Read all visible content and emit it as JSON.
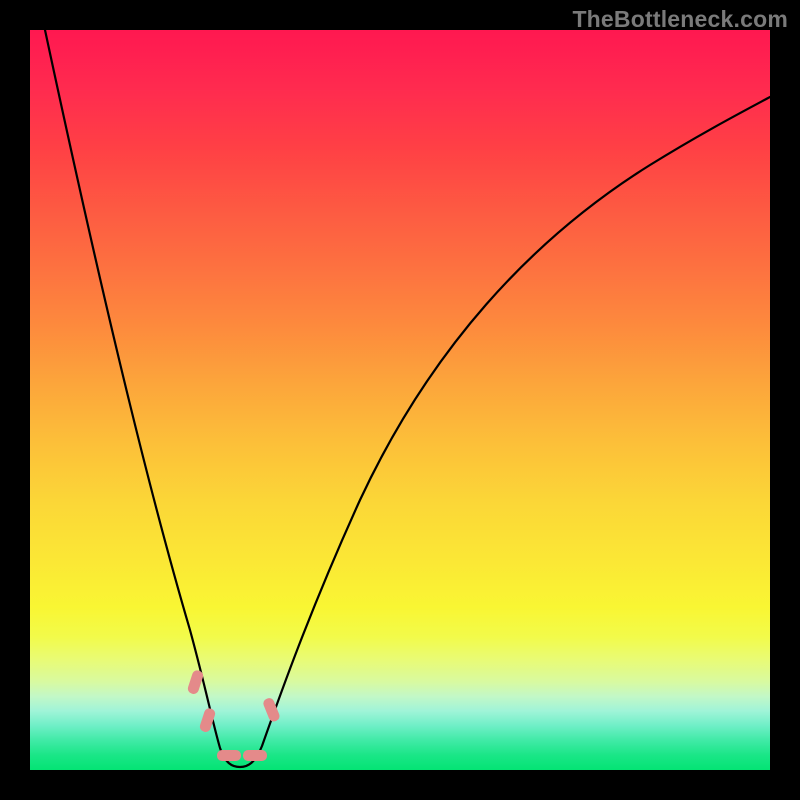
{
  "watermark": "TheBottleneck.com",
  "colors": {
    "page_bg": "#000000",
    "gradient_top": "#ff1850",
    "gradient_bottom": "#04e474",
    "curve": "#000000",
    "marker": "#e48a8a"
  },
  "chart_data": {
    "type": "line",
    "title": "",
    "xlabel": "",
    "ylabel": "",
    "xlim": [
      0,
      100
    ],
    "ylim": [
      0,
      100
    ],
    "grid": false,
    "legend": false,
    "series": [
      {
        "name": "left-branch",
        "x": [
          2,
          4,
          6,
          8,
          10,
          12,
          14,
          16,
          18,
          20,
          22,
          23.5,
          25
        ],
        "y": [
          100,
          93,
          85,
          77,
          68,
          59,
          50,
          41,
          32,
          23,
          14,
          8,
          3
        ]
      },
      {
        "name": "right-branch",
        "x": [
          31,
          33,
          36,
          40,
          45,
          50,
          55,
          60,
          66,
          72,
          78,
          85,
          92,
          100
        ],
        "y": [
          3,
          8,
          16,
          26,
          36,
          44,
          51,
          57,
          63,
          68,
          72,
          77,
          81,
          85
        ]
      },
      {
        "name": "valley-floor",
        "x": [
          25,
          26,
          27,
          28,
          29,
          30,
          31
        ],
        "y": [
          3,
          1.2,
          0.6,
          0.5,
          0.6,
          1.2,
          3
        ]
      }
    ],
    "annotations": [
      {
        "name": "marker-left-upper",
        "x": 22.3,
        "y": 12
      },
      {
        "name": "marker-left-lower",
        "x": 24.0,
        "y": 6
      },
      {
        "name": "marker-floor-left",
        "x": 26.0,
        "y": 1.5
      },
      {
        "name": "marker-floor-right",
        "x": 30.0,
        "y": 1.5
      },
      {
        "name": "marker-right",
        "x": 32.8,
        "y": 8
      }
    ]
  }
}
